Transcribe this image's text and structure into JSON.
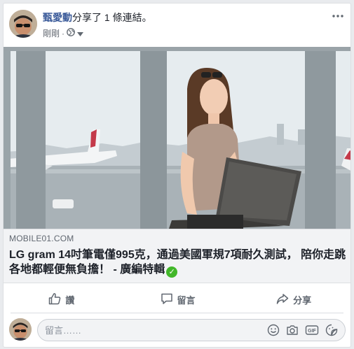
{
  "post": {
    "author": "甄愛動",
    "action_text": "分享了 1 條連結。",
    "timestamp": "剛剛",
    "audience_icon": "globe-icon",
    "more_icon": "more-options-icon"
  },
  "link": {
    "domain": "MOBILE01.COM",
    "title": "LG gram 14吋筆電僅995克，通過美國軍規7項耐久測試， 陪你走跳各地都輕便無負擔！ - 廣編特輯",
    "verified_icon": "checkmark-icon"
  },
  "actions": {
    "like_label": "讚",
    "comment_label": "留言",
    "share_label": "分享"
  },
  "comment": {
    "placeholder": "留言……",
    "icons": [
      "emoji-icon",
      "camera-icon",
      "gif-icon",
      "sticker-icon"
    ]
  },
  "colors": {
    "author": "#385898",
    "secondary": "#606770",
    "link_bg": "#f2f3f5",
    "verified": "#42b72a"
  }
}
